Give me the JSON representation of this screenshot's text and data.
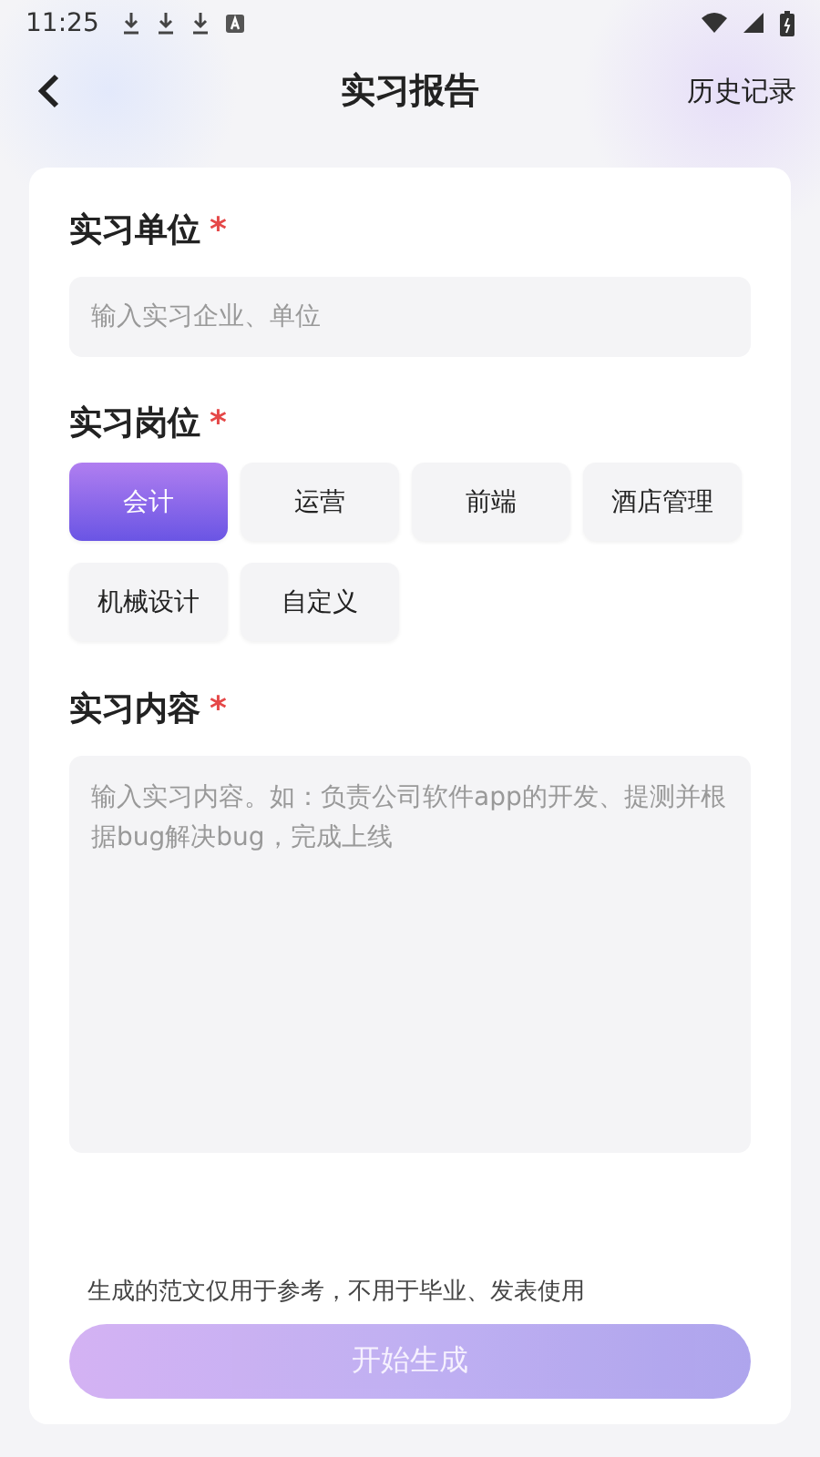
{
  "status_bar": {
    "time": "11:25"
  },
  "header": {
    "title": "实习报告",
    "action": "历史记录"
  },
  "form": {
    "company": {
      "label": "实习单位",
      "required_mark": "*",
      "placeholder": "输入实习企业、单位"
    },
    "position": {
      "label": "实习岗位",
      "required_mark": "*",
      "options": [
        {
          "label": "会计",
          "selected": true
        },
        {
          "label": "运营",
          "selected": false
        },
        {
          "label": "前端",
          "selected": false
        },
        {
          "label": "酒店管理",
          "selected": false
        },
        {
          "label": "机械设计",
          "selected": false
        },
        {
          "label": "自定义",
          "selected": false
        }
      ]
    },
    "content": {
      "label": "实习内容",
      "required_mark": "*",
      "placeholder": "输入实习内容。如：负责公司软件app的开发、提测并根据bug解决bug，完成上线"
    }
  },
  "disclaimer": "生成的范文仅用于参考，不用于毕业、发表使用",
  "generate_button": {
    "label": "开始生成",
    "disabled": true
  }
}
